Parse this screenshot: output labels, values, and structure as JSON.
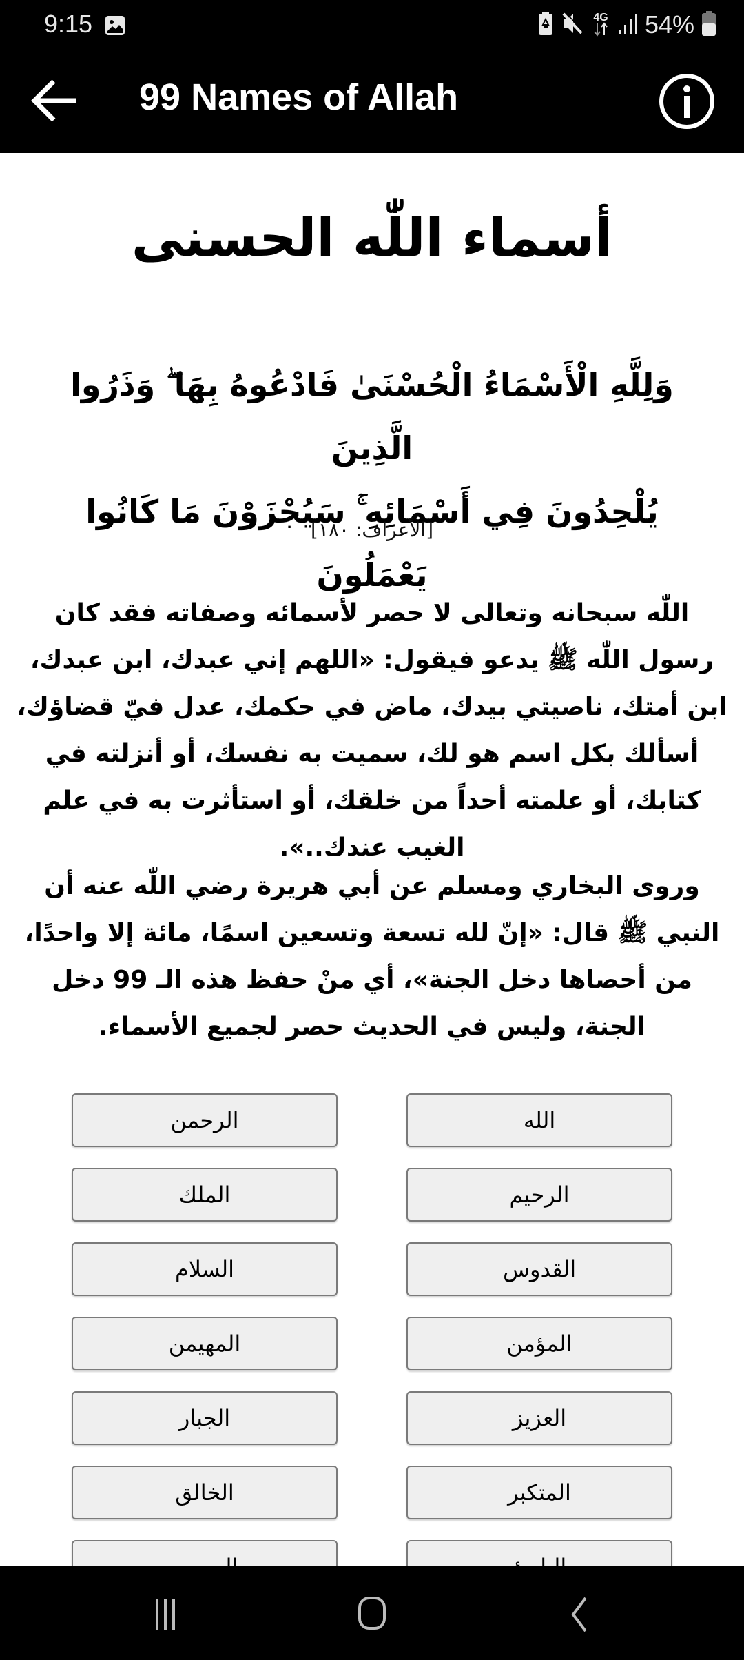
{
  "status_bar": {
    "time": "9:15",
    "icons": [
      "gallery-icon",
      "battery-saver-icon",
      "mute-icon",
      "4g-icon",
      "signal-icon",
      "battery-icon"
    ],
    "network": "4G",
    "battery_percent": "54%",
    "battery_level": 0.54
  },
  "app_bar": {
    "title": "99 Names of Allah",
    "back_icon": "arrow-left-icon",
    "info_icon": "info-icon"
  },
  "content": {
    "heading": "أسماء اللّٰه الحسنى",
    "verse_line1": "وَلِلَّهِ الْأَسْمَاءُ الْحُسْنَىٰ فَادْعُوهُ بِهَا ۖ وَذَرُوا الَّذِينَ",
    "verse_line2": "يُلْحِدُونَ فِي أَسْمَائِهِ ۚ سَيُجْزَوْنَ مَا كَانُوا يَعْمَلُونَ",
    "verse_reference": "[الأعراف: ١٨٠]",
    "paragraph1": "اللّٰه سبحانه وتعالى لا حصر لأسمائه وصفاته فقد كان رسول اللّٰه ﷺ يدعو فيقول: «اللهم إني عبدك، ابن عبدك، ابن أمتك، ناصيتي بيدك، ماض في حكمك، عدل فيّ قضاؤك، أسألك بكل اسم هو لك، سميت به نفسك، أو أنزلته في كتابك، أو علمته أحداً من خلقك، أو استأثرت به في علم الغيب عندك..».",
    "paragraph2": "وروى البخاري ومسلم عن أبي هريرة رضي اللّٰه عنه أن النبي ﷺ قال: «إنّ لله تسعة وتسعين اسمًا، مائة إلا واحدًا، من أحصاها دخل الجنة»، أي منْ حفظ هذه الـ 99 دخل الجنة، وليس في الحديث حصر لجميع الأسماء."
  },
  "names": [
    "الله",
    "الرحمن",
    "الرحيم",
    "الملك",
    "القدوس",
    "السلام",
    "المؤمن",
    "المهيمن",
    "العزيز",
    "الجبار",
    "المتكبر",
    "الخالق",
    "البارئ",
    "المصور"
  ],
  "nav_bar": {
    "recents_icon": "recents-icon",
    "home_icon": "home-icon",
    "back_icon": "back-icon"
  },
  "colors": {
    "bar_background": "#000000",
    "page_background": "#ffffff",
    "button_background": "#efefef",
    "button_border": "#7a7a7a",
    "text": "#000000"
  }
}
